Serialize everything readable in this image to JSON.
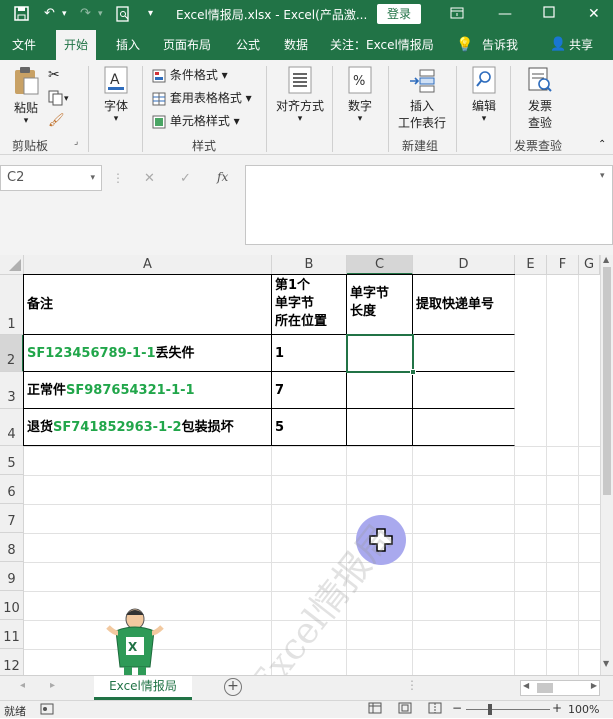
{
  "title_bar": {
    "title": "Excel情报局.xlsx  -  Excel(产品激...",
    "login_label": "登录"
  },
  "tabs": [
    {
      "label": "文件"
    },
    {
      "label": "开始"
    },
    {
      "label": "插入"
    },
    {
      "label": "页面布局"
    },
    {
      "label": "公式"
    },
    {
      "label": "数据"
    },
    {
      "label": "关注：Excel情报局"
    },
    {
      "label": "告诉我"
    },
    {
      "label": "共享"
    }
  ],
  "ribbon": {
    "paste": "粘贴",
    "clipboard_group": "剪贴板",
    "font": "字体",
    "conditional_format": "条件格式",
    "table_format": "套用表格格式",
    "cell_style": "单元格样式",
    "style_group": "样式",
    "alignment": "对齐方式",
    "number": "数字",
    "insert_line1": "插入",
    "insert_line2": "工作表行",
    "newgroup_group": "新建组",
    "edit": "编辑",
    "invoice_line1": "发票",
    "invoice_line2": "查验",
    "invoice_group": "发票查验"
  },
  "formula_bar": {
    "name_box": "C2",
    "fx": "fx",
    "content": ""
  },
  "grid": {
    "col_headers": [
      "A",
      "B",
      "C",
      "D",
      "E",
      "F",
      "G"
    ],
    "row_headers": [
      "1",
      "2",
      "3",
      "4",
      "5",
      "6",
      "7",
      "8",
      "9",
      "10",
      "11",
      "12"
    ],
    "header_row": {
      "a": "备注",
      "b1": "第1个",
      "b2": "单字节",
      "b3": "所在位置",
      "c1": "单字节",
      "c2": "长度",
      "d": "提取快递单号"
    },
    "rows": [
      {
        "a_green": "SF123456789-1-1",
        "a_suffix": "丢失件",
        "b": "1"
      },
      {
        "a_prefix": "正常件",
        "a_green": "SF987654321-1-1",
        "b": "7"
      },
      {
        "a_prefix": "退货",
        "a_green": "SF741852963-1-2",
        "a_suffix": "包装损坏",
        "b": "5"
      }
    ],
    "watermark": "Excel情报局"
  },
  "sheet_tab": "Excel情报局",
  "status": {
    "ready": "就绪",
    "zoom": "100%"
  },
  "colors": {
    "excel_green": "#217346",
    "cell_green": "#21a64a",
    "cursor_circle": "#a9a9ee"
  }
}
